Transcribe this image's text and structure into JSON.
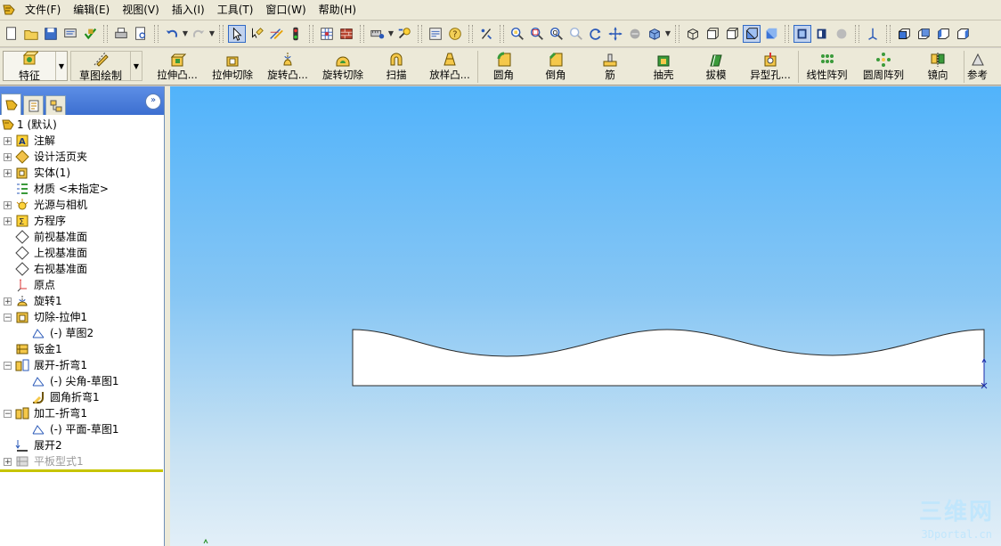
{
  "menubar": {
    "items": [
      "文件(F)",
      "编辑(E)",
      "视图(V)",
      "插入(I)",
      "工具(T)",
      "窗口(W)",
      "帮助(H)"
    ]
  },
  "std_toolbar": {
    "icons": [
      "new-document-icon",
      "open-folder-icon",
      "save-icon",
      "print-setup-icon",
      "rebuild-icon",
      "print-icon",
      "print-preview-icon",
      "undo-icon",
      "redo-icon",
      "select-arrow-icon",
      "select-filter-icon",
      "sketch-icon",
      "traffic-light-icon",
      "grid-icon",
      "brick-icon",
      "measure-icon",
      "options-icon",
      "properties-icon",
      "help-icon",
      "snap-icon",
      "zoom-to-fit-icon",
      "zoom-area-icon",
      "zoom-in-out-icon",
      "zoom-selection-icon",
      "rotate-icon",
      "pan-icon",
      "roll-icon",
      "view-orientation-icon",
      "wireframe-icon",
      "hidden-lines-visible-icon",
      "hidden-lines-removed-icon",
      "shaded-edges-icon",
      "shaded-icon",
      "perspective-icon",
      "section-view-icon",
      "shadows-icon",
      "origin-toggle-icon",
      "front-view-icon",
      "back-view-icon",
      "left-view-icon",
      "right-view-icon"
    ]
  },
  "feature_toolbar": {
    "features_label": "特征",
    "sketch_label": "草图绘制",
    "buttons": [
      "拉伸凸...",
      "拉伸切除",
      "旋转凸...",
      "旋转切除",
      "扫描",
      "放样凸...",
      "圆角",
      "倒角",
      "筋",
      "抽壳",
      "拔模",
      "异型孔...",
      "线性阵列",
      "圆周阵列",
      "镜向",
      "参考"
    ]
  },
  "tree": {
    "root": "1  (默认)",
    "nodes": [
      {
        "label": "注解",
        "expand": "+"
      },
      {
        "label": "设计活页夹",
        "expand": "+"
      },
      {
        "label": "实体(1)",
        "expand": "+"
      },
      {
        "label": "材质 <未指定>",
        "expand": ""
      },
      {
        "label": "光源与相机",
        "expand": "+"
      },
      {
        "label": "方程序",
        "expand": "+"
      },
      {
        "label": "前视基准面",
        "expand": ""
      },
      {
        "label": "上视基准面",
        "expand": ""
      },
      {
        "label": "右视基准面",
        "expand": ""
      },
      {
        "label": "原点",
        "expand": ""
      },
      {
        "label": "旋转1",
        "expand": "+"
      },
      {
        "label": "切除-拉伸1",
        "expand": "−"
      },
      {
        "label": "(-) 草图2",
        "expand": ""
      },
      {
        "label": "钣金1",
        "expand": ""
      },
      {
        "label": "展开-折弯1",
        "expand": "−"
      },
      {
        "label": "(-) 尖角-草图1",
        "expand": ""
      },
      {
        "label": "圆角折弯1",
        "expand": ""
      },
      {
        "label": "加工-折弯1",
        "expand": "−"
      },
      {
        "label": "(-) 平面-草图1",
        "expand": ""
      },
      {
        "label": "展开2",
        "expand": ""
      },
      {
        "label": "平板型式1",
        "expand": "+"
      }
    ]
  },
  "canvas": {
    "watermark": "三维网",
    "watermark_sub": "3Dportal.cn",
    "triad_label": "Y"
  },
  "colors": {
    "accent": "#316ac5",
    "canvas_top": "#51b3fb",
    "canvas_bottom": "#e2eff8",
    "tree_rollback": "#c7c400"
  }
}
